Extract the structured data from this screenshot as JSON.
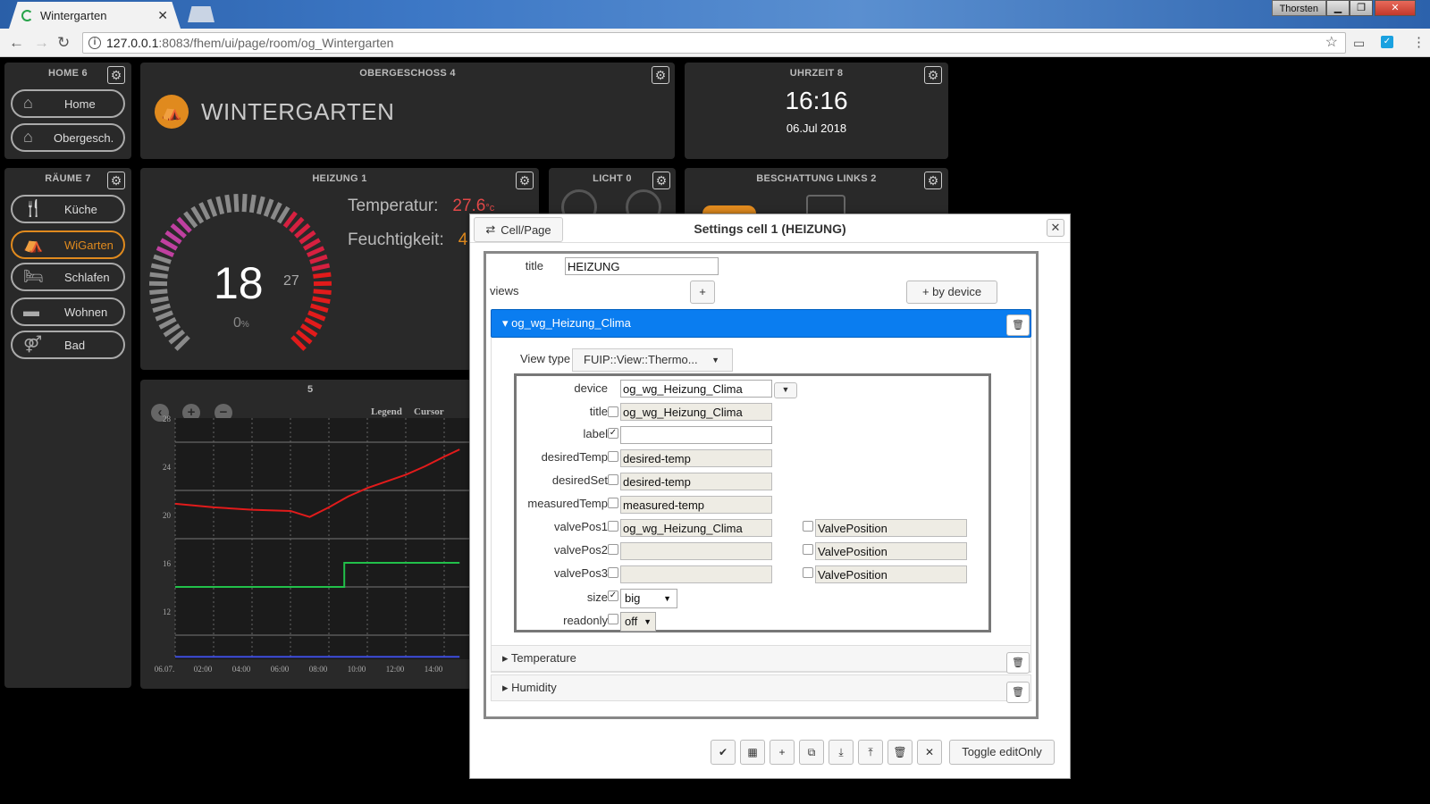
{
  "browser": {
    "tab_title": "Wintergarten",
    "user": "Thorsten",
    "url_host": "127.0.0.1",
    "url_rest": ":8083/fhem/ui/page/room/og_Wintergarten"
  },
  "panels": {
    "home": {
      "title": "HOME 6",
      "items": [
        "Home",
        "Obergesch."
      ]
    },
    "obergeschoss": {
      "title": "OBERGESCHOSS 4",
      "room": "WINTERGARTEN"
    },
    "uhrzeit": {
      "title": "UHRZEIT 8",
      "time": "16:16",
      "date": "06.Jul 2018"
    },
    "raeume": {
      "title": "RÄUME 7",
      "items": [
        "Küche",
        "WiGarten",
        "Schlafen",
        "Wohnen",
        "Bad"
      ],
      "active": "WiGarten"
    },
    "heizung": {
      "title": "HEIZUNG 1",
      "gauge_value": "18",
      "gauge_max": "27",
      "valve": "0",
      "valve_unit": "%",
      "gauge_fraction": 0.3,
      "temp_label": "Temperatur:",
      "temp_value": "27.6",
      "temp_unit": "°c",
      "hum_label": "Feuchtigkeit:",
      "hum_value": "4"
    },
    "licht": {
      "title": "LICHT 0"
    },
    "beschattung": {
      "title": "BESCHATTUNG LINKS 2"
    },
    "chart_panel": {
      "title": "5",
      "legend": "Legend",
      "cursor": "Cursor"
    }
  },
  "chart_data": {
    "type": "line",
    "x": [
      "06.07.",
      "02:00",
      "04:00",
      "06:00",
      "08:00",
      "10:00",
      "12:00",
      "14:00"
    ],
    "yticks": [
      28,
      24,
      20,
      16,
      12
    ],
    "ylim": [
      10,
      30
    ],
    "series": [
      {
        "color": "#e11b1b",
        "points": [
          [
            0,
            22.9
          ],
          [
            1,
            22.6
          ],
          [
            2,
            22.4
          ],
          [
            3,
            22.3
          ],
          [
            3.5,
            21.8
          ],
          [
            4,
            22.6
          ],
          [
            4.5,
            23.5
          ],
          [
            5,
            24.2
          ],
          [
            6,
            25.3
          ],
          [
            6.5,
            26
          ],
          [
            7,
            26.8
          ],
          [
            7.4,
            27.4
          ]
        ]
      },
      {
        "color": "#22c04a",
        "points": [
          [
            0,
            16
          ],
          [
            4.4,
            16
          ],
          [
            4.4,
            18
          ],
          [
            7.4,
            18
          ]
        ]
      },
      {
        "color": "#3d4de0",
        "points": [
          [
            0,
            10.2
          ],
          [
            7.4,
            10.2
          ]
        ]
      }
    ]
  },
  "dialog": {
    "cell_page_btn": "Cell/Page",
    "caption": "Settings cell 1 (HEIZUNG)",
    "title_label": "title",
    "title_value": "HEIZUNG",
    "views_label": "views",
    "add_label": "+",
    "by_device_label": "+ by device",
    "open_view": "og_wg_Heizung_Clima",
    "view_type_label": "View type",
    "view_type_value": "FUIP::View::Thermo...",
    "fields": {
      "device": {
        "label": "device",
        "value": "og_wg_Heizung_Clima"
      },
      "title": {
        "label": "title",
        "value": "og_wg_Heizung_Clima"
      },
      "label": {
        "label": "label",
        "value": ""
      },
      "desiredTemp": {
        "label": "desiredTemp",
        "value": "desired-temp"
      },
      "desiredSet": {
        "label": "desiredSet",
        "value": "desired-temp"
      },
      "measuredTemp": {
        "label": "measuredTemp",
        "value": "measured-temp"
      },
      "valvePos1": {
        "label": "valvePos1",
        "value": "og_wg_Heizung_Clima",
        "reading": "ValvePosition"
      },
      "valvePos2": {
        "label": "valvePos2",
        "value": "",
        "reading": "ValvePosition"
      },
      "valvePos3": {
        "label": "valvePos3",
        "value": "",
        "reading": "ValvePosition"
      },
      "size": {
        "label": "size",
        "value": "big"
      },
      "readonly": {
        "label": "readonly",
        "value": "off"
      }
    },
    "closed_views": [
      "Temperature",
      "Humidity"
    ],
    "toggle_label": "Toggle editOnly"
  },
  "colors": {
    "accent": "#e08a1e",
    "blue": "#0a7df0",
    "panel": "#292929"
  }
}
